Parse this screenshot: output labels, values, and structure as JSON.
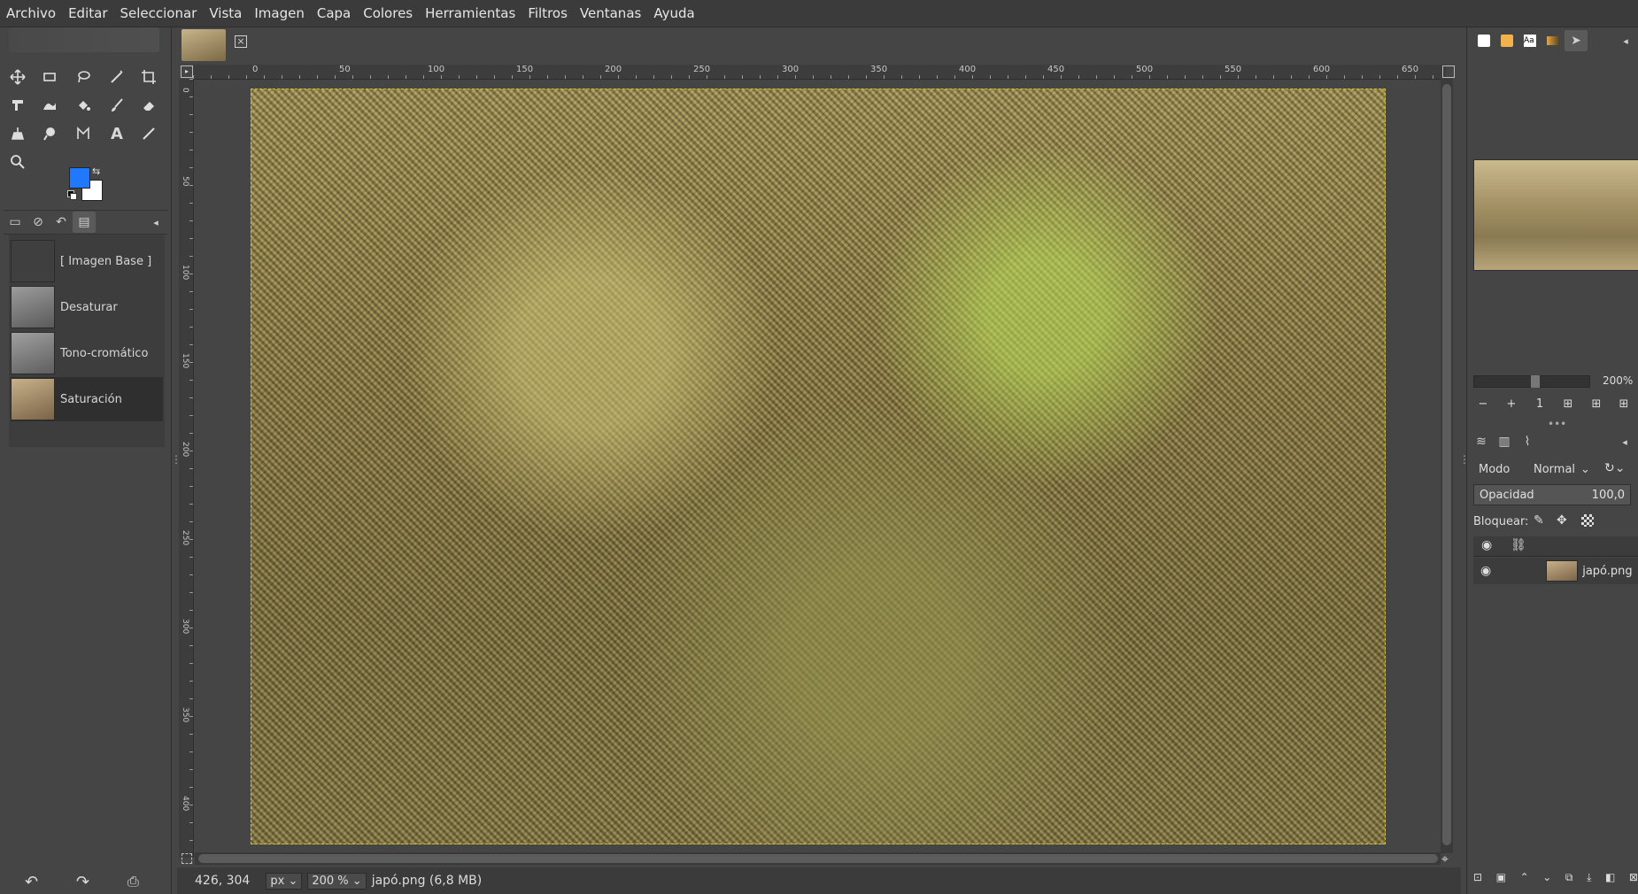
{
  "menubar": [
    "Archivo",
    "Editar",
    "Seleccionar",
    "Vista",
    "Imagen",
    "Capa",
    "Colores",
    "Herramientas",
    "Filtros",
    "Ventanas",
    "Ayuda"
  ],
  "toolbox": {
    "tools": [
      "move-tool",
      "rect-select-tool",
      "free-select-tool",
      "fuzzy-select-tool",
      "crop-tool",
      "transform-tool",
      "warp-tool",
      "bucket-fill-tool",
      "paintbrush-tool",
      "eraser-tool",
      "clone-tool",
      "smudge-tool",
      "path-tool",
      "text-tool",
      "color-picker-tool",
      "zoom-tool"
    ],
    "fg_color": "#1f78ff",
    "bg_color": "#ffffff"
  },
  "history": {
    "items": [
      {
        "label": "[ Imagen Base ]",
        "thumb": "#3f3f3f"
      },
      {
        "label": "Desaturar",
        "thumb": "#8b8b8b"
      },
      {
        "label": "Tono-cromático",
        "thumb": "#8f8f8f"
      },
      {
        "label": "Saturación",
        "thumb": "#a48c6a"
      }
    ],
    "selected_index": 3
  },
  "ruler_top": [
    "0",
    "50",
    "100",
    "150",
    "200",
    "250",
    "300",
    "350",
    "400",
    "450",
    "500",
    "550",
    "600",
    "650"
  ],
  "ruler_left": [
    "0",
    "50",
    "100",
    "150",
    "200",
    "250",
    "300",
    "350",
    "400"
  ],
  "statusbar": {
    "coords": "426, 304",
    "unit": "px",
    "zoom": "200 %",
    "file": "japó.png (6,8 MB)"
  },
  "navigator": {
    "zoom_label": "200%",
    "zoom_level": 0.45
  },
  "layers": {
    "mode_label": "Modo",
    "mode_value": "Normal",
    "opacity_label": "Opacidad",
    "opacity_value": "100,0",
    "lock_label": "Bloquear:",
    "layer_name": "japó.png"
  }
}
